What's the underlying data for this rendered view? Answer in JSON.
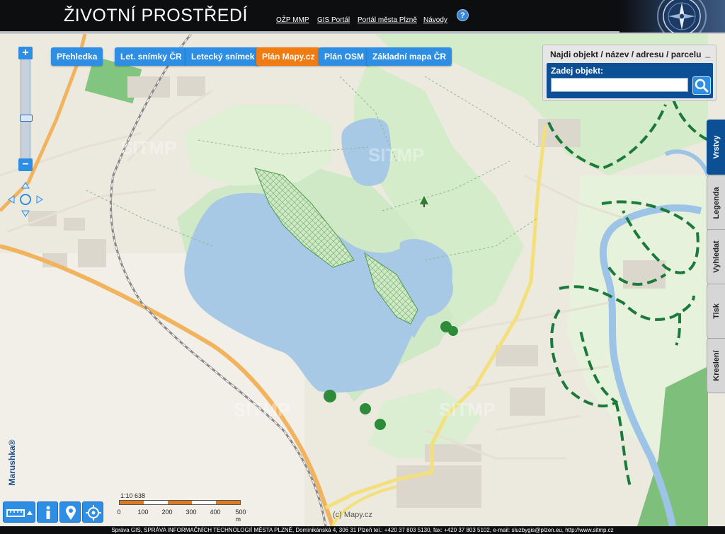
{
  "header": {
    "title": "ŽIVOTNÍ PROSTŘEDÍ",
    "links": [
      "OŽP MMP",
      "GIS Portál",
      "Portál města Plzně",
      "Návody"
    ],
    "help_label": "?"
  },
  "basemaps": {
    "buttons": [
      "Přehledka",
      "Let. snímky ČR",
      "Letecký snímek",
      "Plán Mapy.cz",
      "Plán OSM",
      "Základní mapa ČR"
    ],
    "active": "Plán Mapy.cz"
  },
  "zoom": {
    "plus": "+",
    "minus": "−"
  },
  "search": {
    "title": "Najdi objekt / název / adresu / parcelu",
    "minimize": "_",
    "label": "Zadej objekt:",
    "value": "",
    "placeholder": ""
  },
  "side_tabs": [
    "Vrstvy",
    "Legenda",
    "Vyhledat",
    "Tisk",
    "Kreslení"
  ],
  "active_tab": "Vrstvy",
  "watermark": {
    "left": "Marushka®",
    "center": "SITMP"
  },
  "scale": {
    "ratio": "1:10 638",
    "ticks": [
      "0",
      "100",
      "200",
      "300",
      "400",
      "500 m"
    ]
  },
  "attribution": "(c) Mapy.cz",
  "tools": [
    "ruler-icon",
    "info-icon",
    "gps-pin-icon",
    "locate-icon"
  ],
  "footer": "Správa GIS, SPRÁVA INFORMAČNÍCH TECHNOLOGIÍ MĚSTA PLZNĚ, Dominikánská 4, 306 31 Plzeň tel.: +420 37 803 5130, fax: +420 37 803 5102, e-mail: sluzbygis@plzen.eu, http://www.sitmp.cz",
  "colors": {
    "header_bg": "#0d0e10",
    "button_blue": "#2d8ee3",
    "button_active": "#f07b13",
    "panel_blue": "#0c4f95",
    "water": "#a7c9e6",
    "forest": "#cde9c2",
    "road_orange": "#f2b35f",
    "road_yellow": "#f3e07a"
  }
}
